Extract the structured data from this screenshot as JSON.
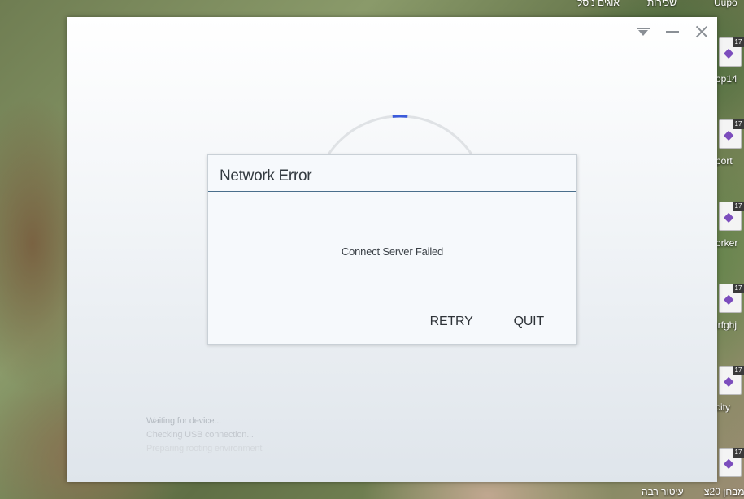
{
  "desktop": {
    "top_labels": [
      "אוגים ניסל",
      "שכירות",
      "Uupo"
    ],
    "bottom_labels": [
      "עיטור רבה",
      "מבחן 20צ"
    ],
    "icons": [
      {
        "caption": "op14",
        "badge": "17",
        "icon": "visual-studio-icon"
      },
      {
        "caption": "port",
        "badge": "17",
        "icon": "visual-studio-icon"
      },
      {
        "caption": "orker",
        "badge": "17",
        "icon": "visual-studio-icon"
      },
      {
        "caption": "lrfghj",
        "badge": "17",
        "icon": "visual-studio-icon"
      },
      {
        "caption": "city",
        "badge": "17",
        "icon": "visual-studio-icon"
      },
      {
        "caption": "",
        "badge": "17",
        "icon": "visual-studio-icon"
      }
    ]
  },
  "window": {
    "controls": [
      "dropdown-icon",
      "minimize-icon",
      "close-icon"
    ],
    "status_lines": [
      "Waiting for device...",
      "Checking USB connection...",
      "Preparing rooting environment"
    ],
    "accent_color": "#3b5bdb"
  },
  "dialog": {
    "title": "Network Error",
    "message": "Connect Server Failed",
    "retry_label": "RETRY",
    "quit_label": "QUIT",
    "divider_color": "#4a6f8c"
  }
}
